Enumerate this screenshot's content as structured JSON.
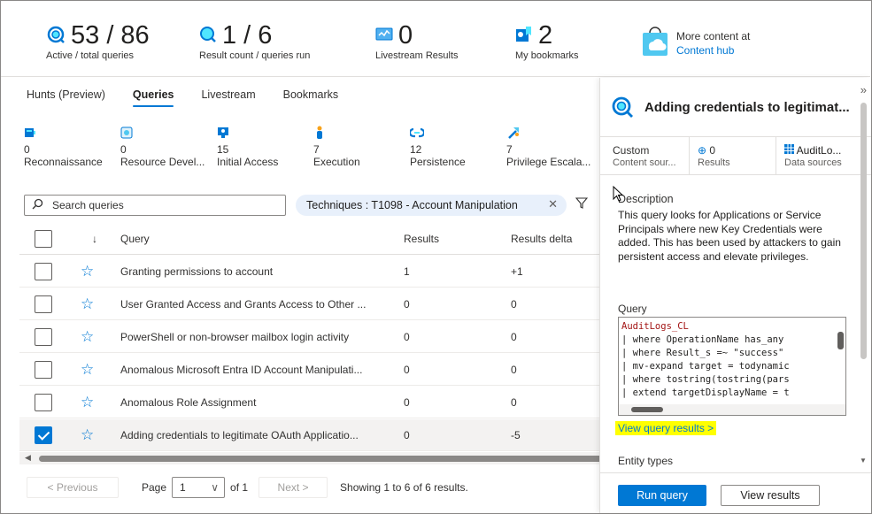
{
  "stats": [
    {
      "icon": "queries-icon",
      "value": "53 / 86",
      "label": "Active / total queries"
    },
    {
      "icon": "results-icon",
      "value": "1 / 6",
      "label": "Result count / queries run"
    },
    {
      "icon": "livestream-icon",
      "value": "0",
      "label": "Livestream Results"
    },
    {
      "icon": "bookmark-icon",
      "value": "2",
      "label": "My bookmarks"
    }
  ],
  "content_hub": {
    "line1": "More content at",
    "link": "Content hub"
  },
  "tabs": [
    "Hunts (Preview)",
    "Queries",
    "Livestream",
    "Bookmarks"
  ],
  "active_tab": "Queries",
  "tactics": [
    {
      "count": "0",
      "name": "Reconnaissance",
      "icon": "reconnaissance-icon"
    },
    {
      "count": "0",
      "name": "Resource Devel...",
      "icon": "resource-development-icon"
    },
    {
      "count": "15",
      "name": "Initial Access",
      "icon": "initial-access-icon"
    },
    {
      "count": "7",
      "name": "Execution",
      "icon": "execution-icon"
    },
    {
      "count": "12",
      "name": "Persistence",
      "icon": "persistence-icon"
    },
    {
      "count": "7",
      "name": "Privilege Escala...",
      "icon": "privilege-escalation-icon"
    }
  ],
  "search": {
    "placeholder": "Search queries"
  },
  "filter_pill": "Techniques : T1098 - Account Manipulation",
  "table": {
    "headers": {
      "query": "Query",
      "results": "Results",
      "delta": "Results delta"
    },
    "rows": [
      {
        "query": "Granting permissions to account",
        "results": "1",
        "delta": "+1",
        "checked": false
      },
      {
        "query": "User Granted Access and Grants Access to Other ...",
        "results": "0",
        "delta": "0",
        "checked": false
      },
      {
        "query": "PowerShell or non-browser mailbox login activity",
        "results": "0",
        "delta": "0",
        "checked": false
      },
      {
        "query": "Anomalous Microsoft Entra ID Account Manipulati...",
        "results": "0",
        "delta": "0",
        "checked": false
      },
      {
        "query": "Anomalous Role Assignment",
        "results": "0",
        "delta": "0",
        "checked": false
      },
      {
        "query": "Adding credentials to legitimate OAuth Applicatio...",
        "results": "0",
        "delta": "-5",
        "checked": true
      }
    ]
  },
  "pager": {
    "prev": "< Previous",
    "page_label": "Page",
    "page_value": "1",
    "of": "of 1",
    "next": "Next >",
    "showing": "Showing 1 to 6 of 6 results."
  },
  "panel": {
    "title": "Adding credentials to legitimat...",
    "meta": [
      {
        "value": "Custom",
        "label": "Content sour..."
      },
      {
        "value": "0",
        "label": "Results"
      },
      {
        "value": "AuditLo...",
        "label": "Data sources"
      }
    ],
    "description_header": "Description",
    "description": "This query looks for Applications or Service Principals where new Key Credentials were added. This has been used by attackers to gain persistent access and elevate privileges.",
    "query_header": "Query",
    "code_lines": [
      "AuditLogs_CL",
      "| where OperationName has_any",
      "| where Result_s =~ \"success\"",
      "| mv-expand target = todynamic",
      "| where tostring(tostring(pars",
      "| extend targetDisplayName = t"
    ],
    "view_query_results": "View query results >",
    "entity_types": "Entity types",
    "run_query": "Run query",
    "view_results": "View results"
  },
  "colors": {
    "accent": "#0078d4",
    "highlight": "#ffff00"
  }
}
